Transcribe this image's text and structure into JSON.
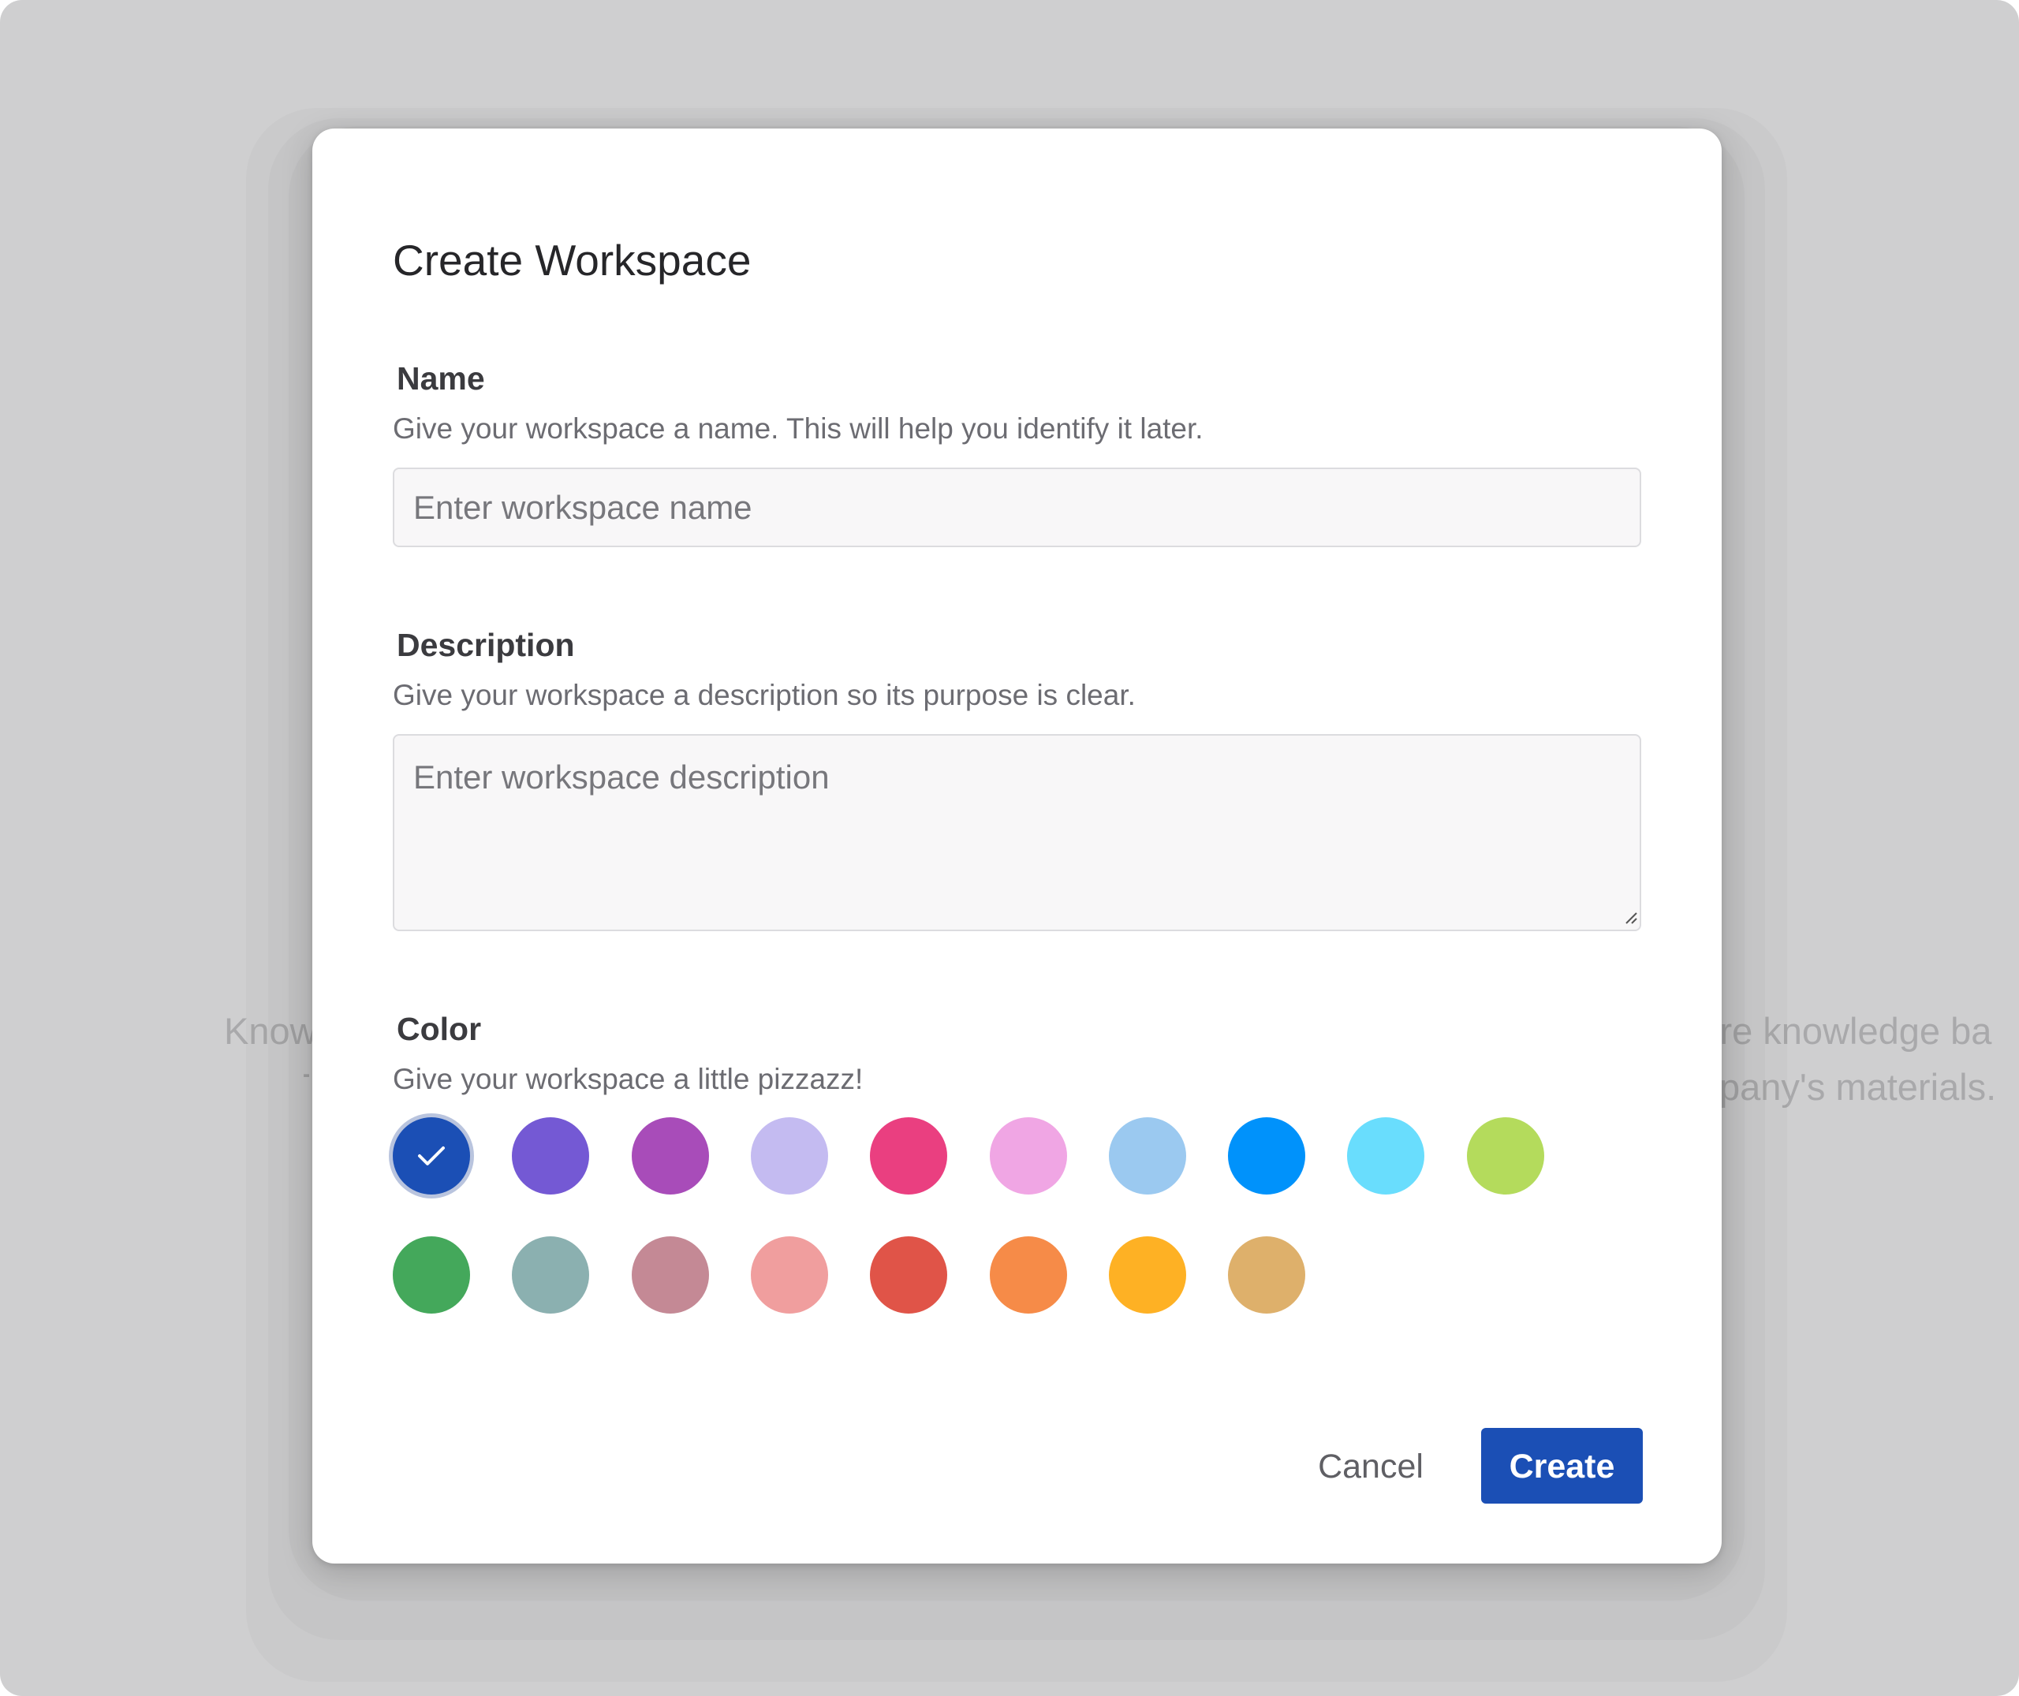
{
  "background": {
    "left_line_1": "Know",
    "left_line_2": "T",
    "right_line_1": "ire knowledge ba",
    "right_line_2": "pany's materials."
  },
  "dialog": {
    "title": "Create Workspace",
    "name": {
      "label": "Name",
      "help": "Give your workspace a name. This will help you identify it later.",
      "placeholder": "Enter workspace name",
      "value": ""
    },
    "description": {
      "label": "Description",
      "help": "Give your workspace a description so its purpose is clear.",
      "placeholder": "Enter workspace description",
      "value": ""
    },
    "color": {
      "label": "Color",
      "help": "Give your workspace a little pizzazz!",
      "selected_index": 0,
      "swatches": [
        "#1b4fb5",
        "#7459d4",
        "#a84cb9",
        "#c4bbf1",
        "#ea3f80",
        "#f0a6e4",
        "#9bc9f0",
        "#0092fb",
        "#69ddfd",
        "#b4db5c",
        "#44a85b",
        "#8bb0b0",
        "#c48995",
        "#f09e9e",
        "#e05448",
        "#f68b48",
        "#feb124",
        "#deb06b"
      ]
    },
    "actions": {
      "cancel": "Cancel",
      "create": "Create"
    }
  },
  "colors": {
    "accent": "#1b4fb5",
    "overlay": "#cfcfd0"
  }
}
